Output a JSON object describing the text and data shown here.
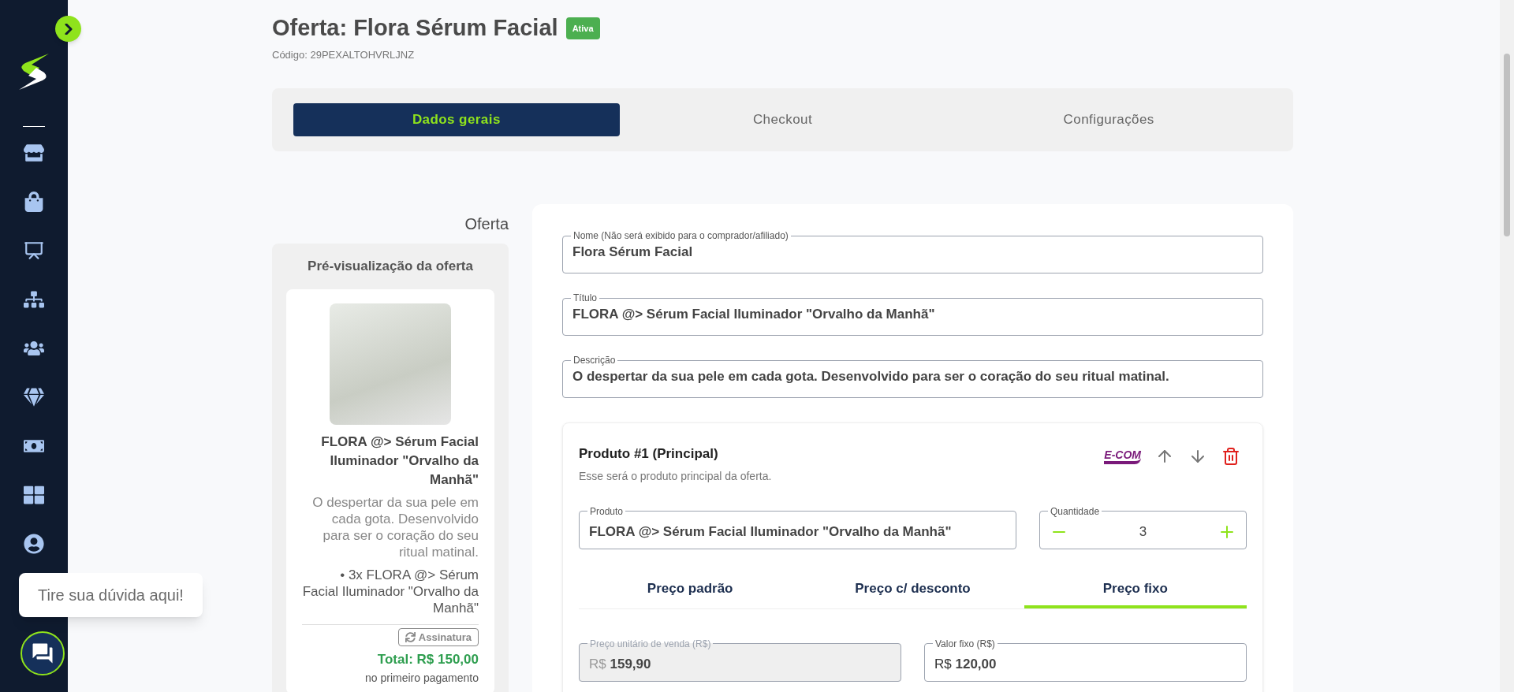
{
  "header": {
    "title": "Oferta: Flora Sérum Facial",
    "status": "Ativa",
    "code": "Código: 29PEXALTOHVRLJNZ"
  },
  "tabs": [
    {
      "label": "Dados gerais",
      "selected": true
    },
    {
      "label": "Checkout",
      "selected": false
    },
    {
      "label": "Configurações",
      "selected": false
    }
  ],
  "preview": {
    "section_label": "Oferta",
    "title": "Pré-visualização da oferta",
    "product_title": "FLORA @> Sérum Facial Iluminador \"Orvalho da Manhã\"",
    "description": "O despertar da sua pele em cada gota. Desenvolvido para ser o coração do seu ritual matinal.",
    "items": [
      "• 3x FLORA @> Sérum Facial Iluminador \"Orvalho da Manhã\""
    ],
    "billing_badge": "Assinatura",
    "total": "Total: R$ 150,00",
    "total_note": "no primeiro pagamento"
  },
  "fields": [
    {
      "label": "Nome (Não será exibido para o comprador/afiliado)",
      "value": "Flora Sérum Facial"
    },
    {
      "label": "Título",
      "value": "FLORA @> Sérum Facial Iluminador \"Orvalho da Manhã\""
    },
    {
      "label": "Descrição",
      "value": "O despertar da sua pele em cada gota. Desenvolvido para ser o coração do seu ritual matinal."
    }
  ],
  "product": {
    "title": "Produto #1 (Principal)",
    "subtitle": "Esse será o produto principal da oferta.",
    "logo": "E-COM",
    "product_field": {
      "label": "Produto",
      "value": "FLORA @> Sérum Facial Iluminador \"Orvalho da Manhã\""
    },
    "quantity": {
      "label": "Quantidade",
      "value": "3"
    },
    "price_tabs": [
      {
        "label": "Preço padrão",
        "selected": false
      },
      {
        "label": "Preço c/ desconto",
        "selected": false
      },
      {
        "label": "Preço fixo",
        "selected": true
      }
    ],
    "price_fields": [
      {
        "label": "Preço unitário de venda (R$)",
        "prefix": "R$",
        "value": "159,90",
        "disabled": true
      },
      {
        "label": "Valor fixo (R$)",
        "prefix": "R$",
        "value": "120,00",
        "disabled": false
      }
    ]
  },
  "chat": {
    "tooltip": "Tire sua dúvida aqui!"
  }
}
